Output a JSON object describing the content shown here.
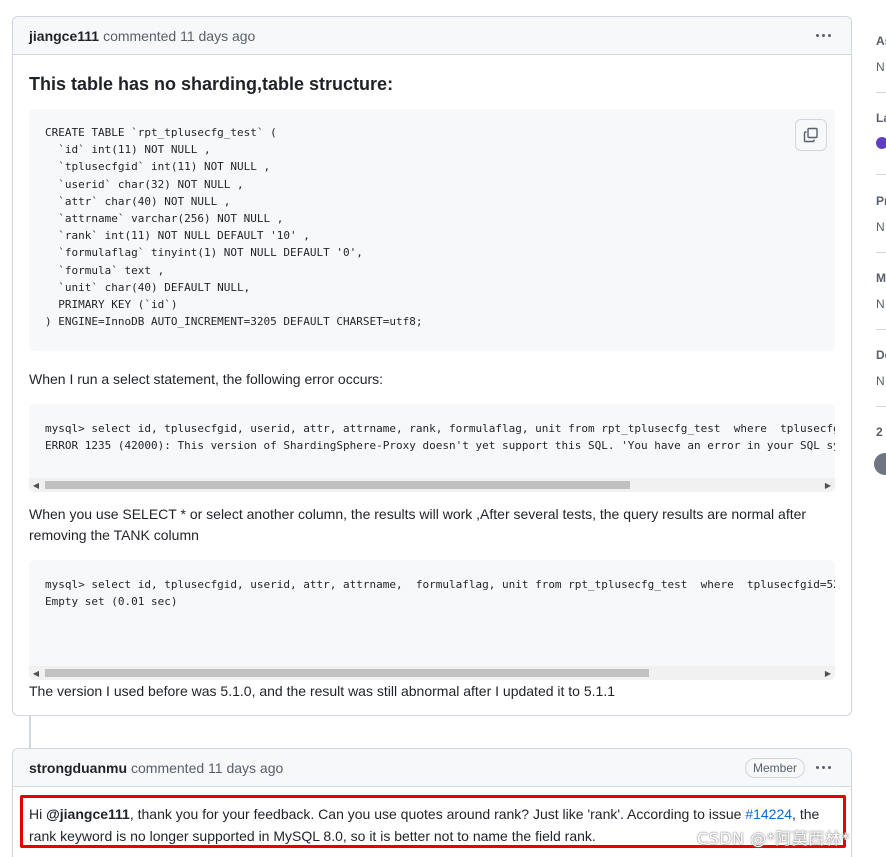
{
  "comment1": {
    "author": "jiangce111",
    "meta": "commented 11 days ago",
    "heading": "This table has no sharding,table structure:",
    "code_create": "CREATE TABLE `rpt_tplusecfg_test` (\n  `id` int(11) NOT NULL ,\n  `tplusecfgid` int(11) NOT NULL ,\n  `userid` char(32) NOT NULL ,\n  `attr` char(40) NOT NULL ,\n  `attrname` varchar(256) NOT NULL ,\n  `rank` int(11) NOT NULL DEFAULT '10' ,\n  `formulaflag` tinyint(1) NOT NULL DEFAULT '0',\n  `formula` text ,\n  `unit` char(40) DEFAULT NULL,\n  PRIMARY KEY (`id`)\n) ENGINE=InnoDB AUTO_INCREMENT=3205 DEFAULT CHARSET=utf8;",
    "para1": "When I run a select statement, the following error occurs:",
    "code_error": "mysql> select id, tplusecfgid, userid, attr, attrname, rank, formulaflag, unit from rpt_tplusecfg_test  where  tplusecfg\nERROR 1235 (42000): This version of ShardingSphere-Proxy doesn't yet support this SQL. 'You have an error in your SQL sy",
    "para2": "When you use SELECT * or select another column, the results will work ,After several tests, the query results are normal after removing the TANK column",
    "code_ok": "mysql> select id, tplusecfgid, userid, attr, attrname,  formulaflag, unit from rpt_tplusecfg_test  where  tplusecfgid=52\nEmpty set (0.01 sec)",
    "para3": "The version I used before was 5.1.0, and the result was still abnormal after I updated it to 5.1.1",
    "scroll_code_error": 0.91,
    "scroll_code_ok": 0.94
  },
  "comment2": {
    "author": "strongduanmu",
    "meta": "commented 11 days ago",
    "badge": "Member",
    "text_hi": "Hi ",
    "mention": "@jiangce111",
    "text_mid": ", thank you for your feedback. Can you use quotes around rank? Just like 'rank'. According to issue ",
    "issue_link": "#14224",
    "text_end": ", the rank keyword is no longer supported in MySQL 8.0, so it is better not to name the field rank."
  },
  "sidebar": {
    "sections": [
      {
        "title": "As",
        "value": "N"
      },
      {
        "title": "La",
        "value": ""
      },
      {
        "title": "Pr",
        "value": "N"
      },
      {
        "title": "M",
        "value": "N"
      },
      {
        "title": "De",
        "value": "N"
      },
      {
        "title": "2",
        "value": ""
      }
    ]
  },
  "watermark": "CSDN @*阿莫西林*",
  "icons": {
    "copy": "copy-icon",
    "kebab": "kebab-horizontal-icon",
    "scroll_left": "scroll-left-arrow-icon",
    "scroll_right": "scroll-right-arrow-icon"
  },
  "colors": {
    "highlight_border": "#e60000",
    "link": "#0969da",
    "label_dot": "#5f3dc4"
  }
}
